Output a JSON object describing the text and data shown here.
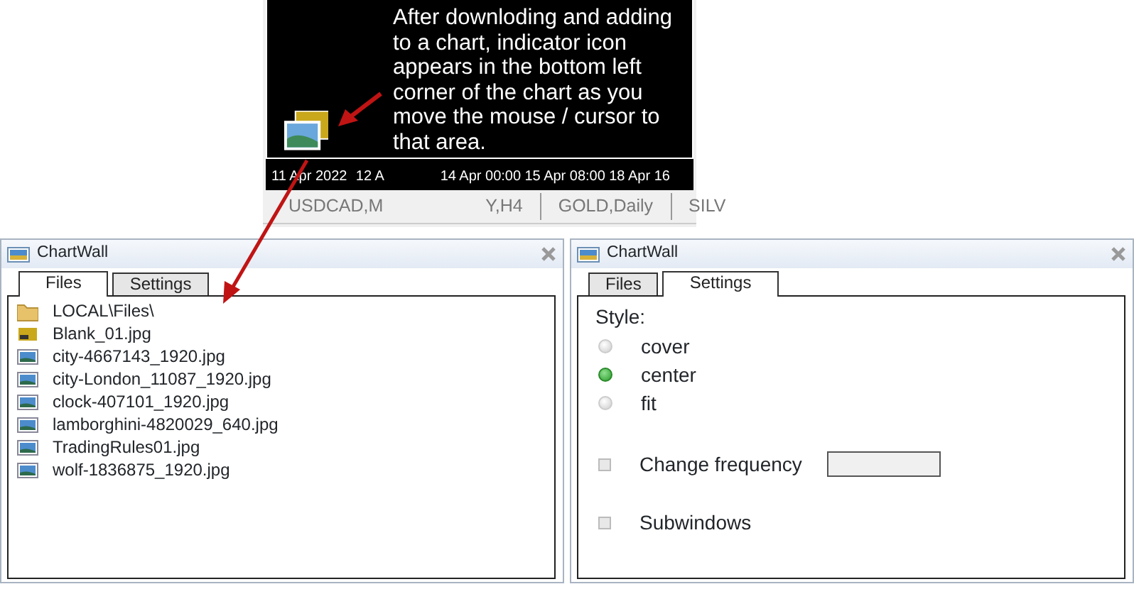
{
  "chart": {
    "note": "After downloding and adding to a chart, indicator icon appears in the bottom left corner of the chart as you move the mouse / cursor to that area.",
    "time_axis": [
      "11 Apr 2022",
      "12 A",
      "14 Apr 00:00",
      "15 Apr 08:00",
      "18 Apr 16"
    ],
    "symbol_tabs": [
      "USDCAD,M",
      "Y,H4",
      "GOLD,Daily",
      "SILV"
    ]
  },
  "panels": [
    {
      "title": "ChartWall",
      "tabs": [
        {
          "label": "Files",
          "selected": true
        },
        {
          "label": "Settings",
          "selected": false
        }
      ],
      "files": [
        {
          "name": "LOCAL\\Files\\",
          "kind": "folder"
        },
        {
          "name": "Blank_01.jpg",
          "kind": "goldimage"
        },
        {
          "name": "city-4667143_1920.jpg",
          "kind": "image"
        },
        {
          "name": "city-London_11087_1920.jpg",
          "kind": "image"
        },
        {
          "name": "clock-407101_1920.jpg",
          "kind": "image"
        },
        {
          "name": "lamborghini-4820029_640.jpg",
          "kind": "image"
        },
        {
          "name": "TradingRules01.jpg",
          "kind": "image"
        },
        {
          "name": "wolf-1836875_1920.jpg",
          "kind": "image"
        }
      ]
    },
    {
      "title": "ChartWall",
      "tabs": [
        {
          "label": "Files",
          "selected": false
        },
        {
          "label": "Settings",
          "selected": true
        }
      ],
      "style_label": "Style:",
      "style_options": [
        {
          "label": "cover",
          "selected": false
        },
        {
          "label": "center",
          "selected": true
        },
        {
          "label": "fit",
          "selected": false
        }
      ],
      "options": [
        {
          "label": "Change frequency",
          "checked": false,
          "kind": "field"
        },
        {
          "label": "Subwindows",
          "checked": false,
          "kind": "plain"
        }
      ]
    }
  ]
}
